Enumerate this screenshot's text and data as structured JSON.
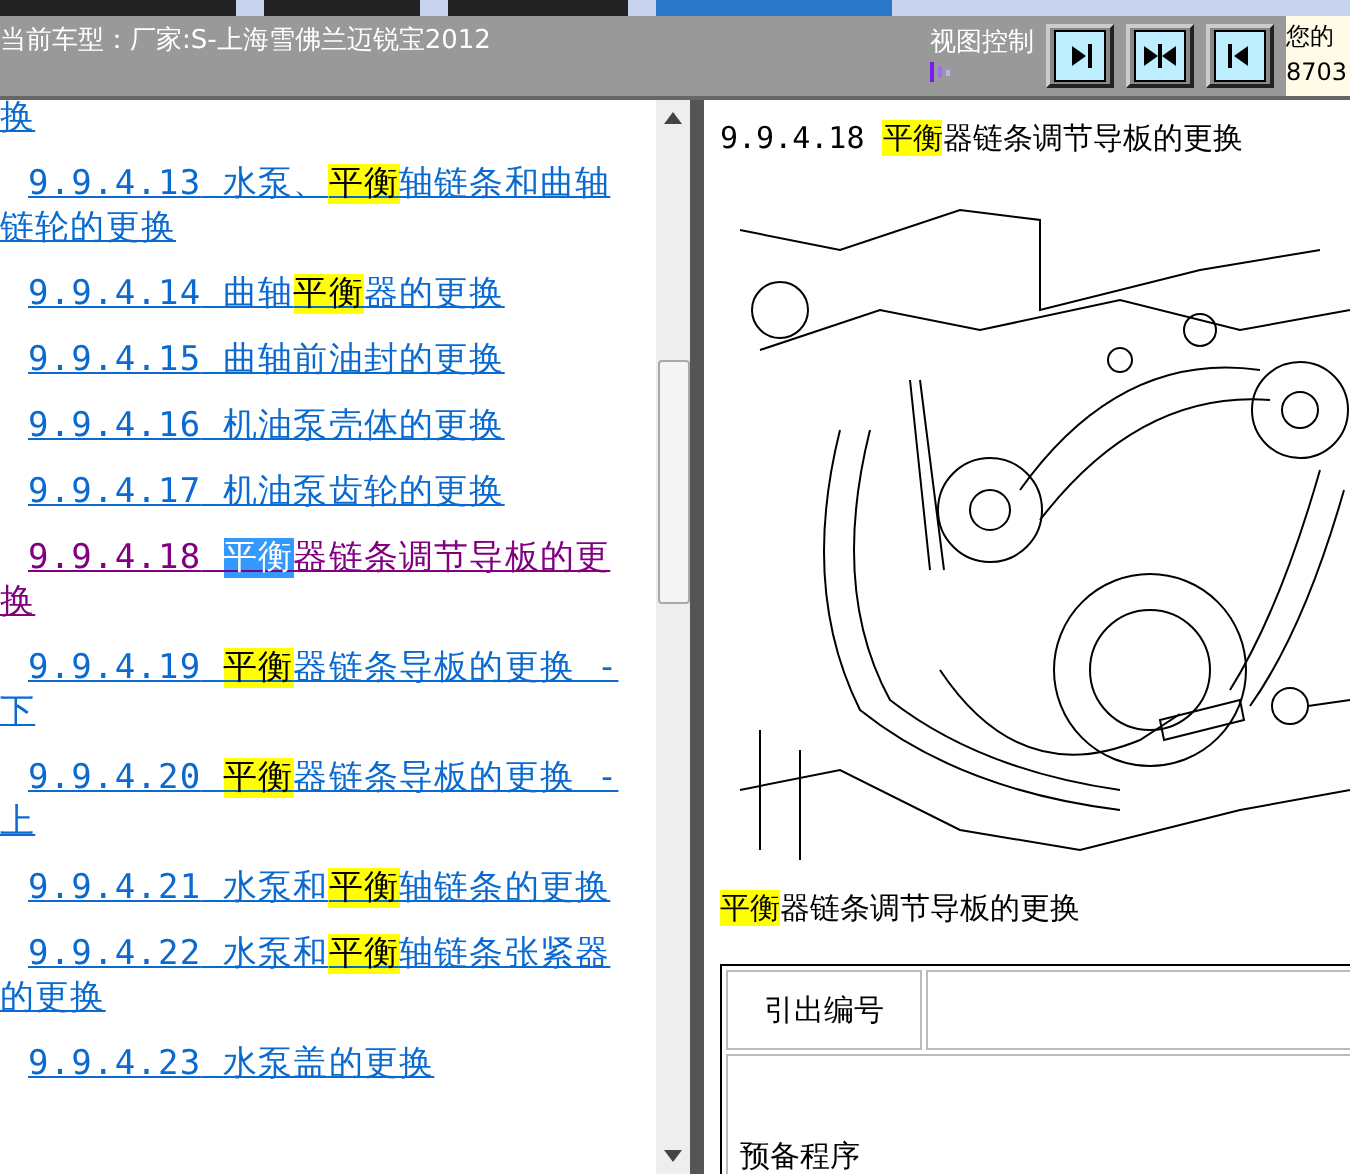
{
  "header": {
    "vehicle_label": "当前车型：厂家:S-上海雪佛兰迈锐宝2012",
    "view_control_label": "视图控制",
    "view_buttons": [
      {
        "kind": "right"
      },
      {
        "kind": "both"
      },
      {
        "kind": "left"
      }
    ],
    "account_lines": [
      "您的",
      "8703"
    ]
  },
  "toc": [
    {
      "kind": "continuation",
      "text": "换"
    },
    {
      "kind": "link",
      "number": "9.9.4.13",
      "before": "水泵、",
      "highlight": {
        "text": "平衡",
        "selected": false
      },
      "after": "轴链条和曲轴链轮的更换",
      "visited": false
    },
    {
      "kind": "link",
      "number": "9.9.4.14",
      "before": "曲轴",
      "highlight": {
        "text": "平衡",
        "selected": false
      },
      "after": "器的更换",
      "visited": false
    },
    {
      "kind": "link",
      "number": "9.9.4.15",
      "before": "曲轴前油封的更换",
      "visited": false
    },
    {
      "kind": "link",
      "number": "9.9.4.16",
      "before": "机油泵壳体的更换",
      "visited": false
    },
    {
      "kind": "link",
      "number": "9.9.4.17",
      "before": "机油泵齿轮的更换",
      "visited": false
    },
    {
      "kind": "link",
      "number": "9.9.4.18",
      "highlight": {
        "text": "平衡",
        "selected": true
      },
      "after": "器链条调节导板的更换",
      "visited": true
    },
    {
      "kind": "link",
      "number": "9.9.4.19",
      "highlight": {
        "text": "平衡",
        "selected": false
      },
      "after": "器链条导板的更换 - 下",
      "visited": false
    },
    {
      "kind": "link",
      "number": "9.9.4.20",
      "highlight": {
        "text": "平衡",
        "selected": false
      },
      "after": "器链条导板的更换 - 上",
      "visited": false
    },
    {
      "kind": "link",
      "number": "9.9.4.21",
      "before": "水泵和",
      "highlight": {
        "text": "平衡",
        "selected": false
      },
      "after": "轴链条的更换",
      "visited": false
    },
    {
      "kind": "link",
      "number": "9.9.4.22",
      "before": "水泵和",
      "highlight": {
        "text": "平衡",
        "selected": false
      },
      "after": "轴链条张紧器的更换",
      "visited": false
    },
    {
      "kind": "link",
      "number": "9.9.4.23",
      "before": "水泵盖的更换",
      "visited": false
    }
  ],
  "document": {
    "heading": {
      "number": "9.9.4.18",
      "highlight": "平衡",
      "after": "器链条调节导板的更换"
    },
    "caption": {
      "highlight": "平衡",
      "after": "器链条调节导板的更换"
    },
    "table": {
      "header_cell": "引出编号",
      "section": "预备程序"
    }
  }
}
